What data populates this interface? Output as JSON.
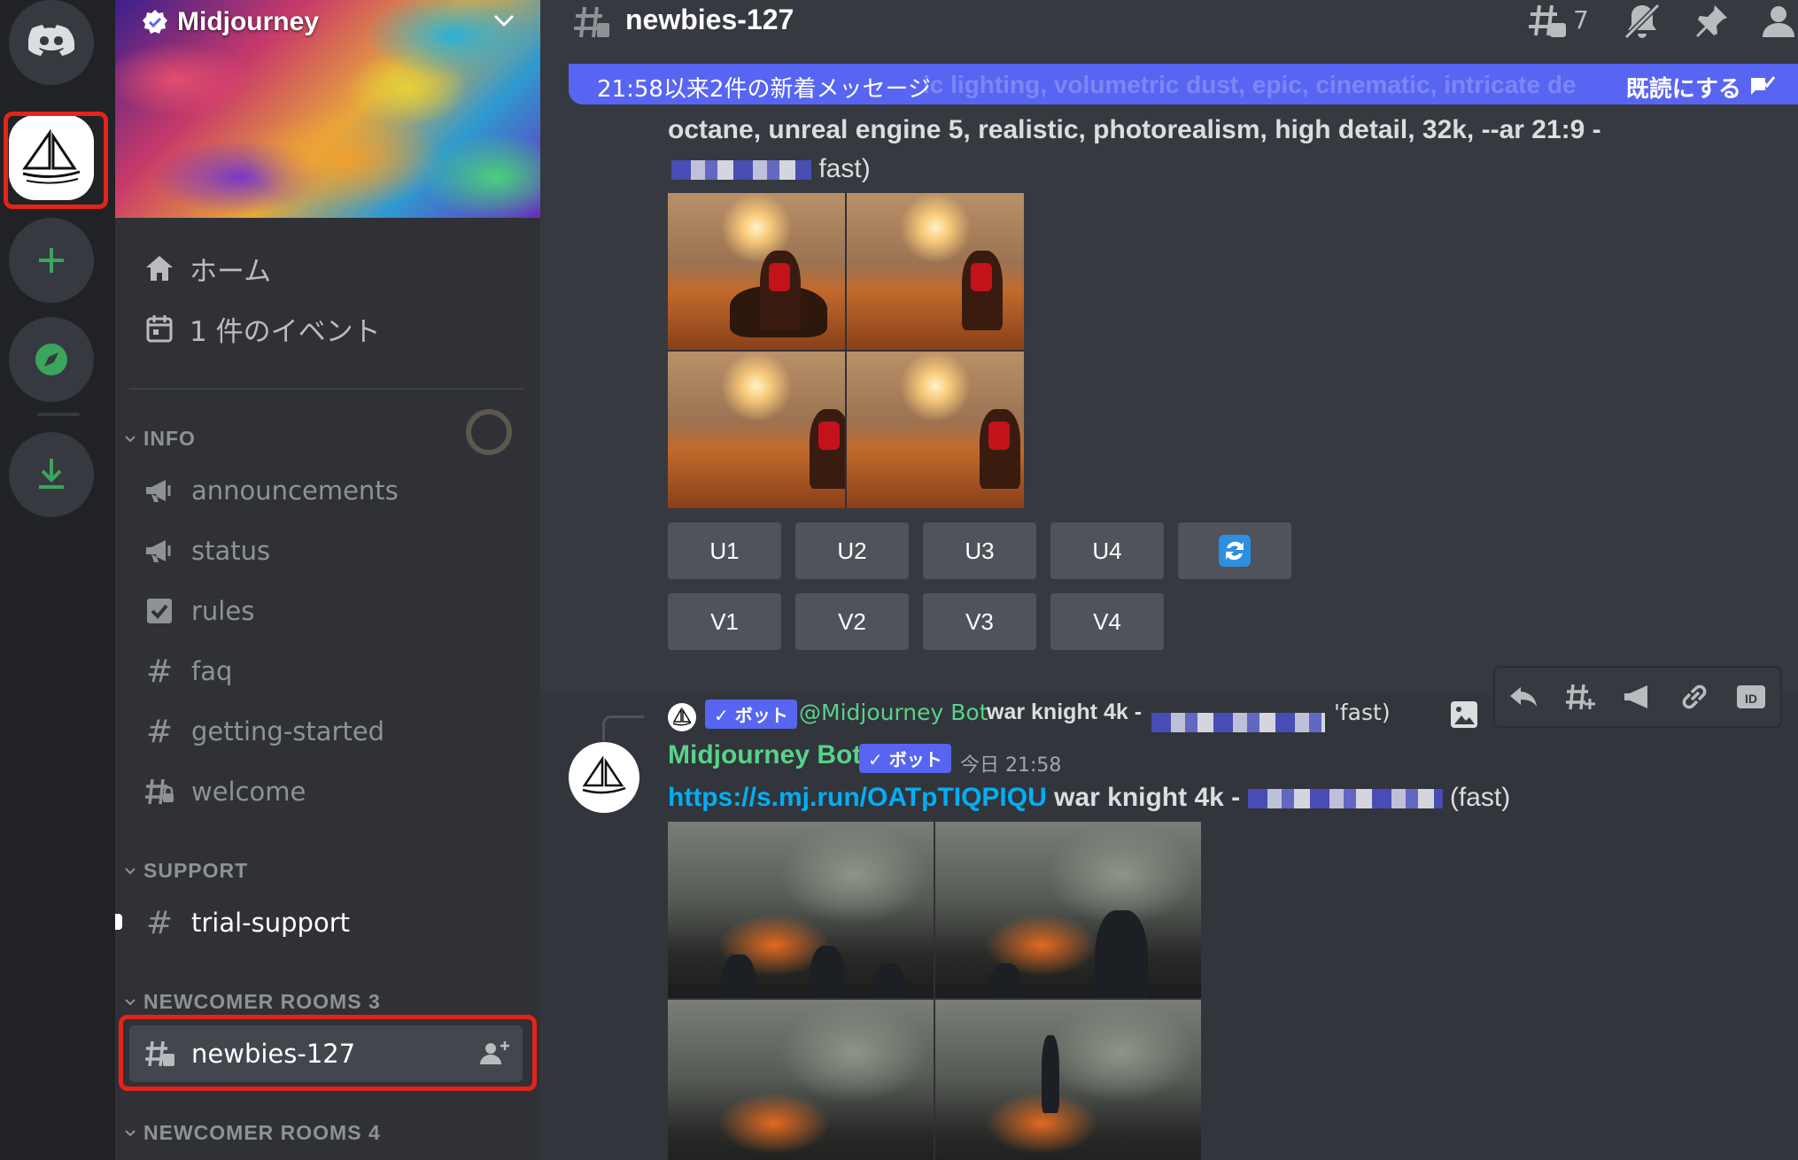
{
  "server": {
    "name": "Midjourney",
    "rail_icons": [
      "discord-home-icon",
      "midjourney-server-icon",
      "add-server-icon",
      "explore-icon",
      "download-icon"
    ]
  },
  "sidebar": {
    "nav": [
      {
        "label": "ホーム",
        "icon": "home-icon"
      },
      {
        "label": "1 件のイベント",
        "icon": "calendar-icon"
      }
    ],
    "categories": [
      {
        "name": "INFO",
        "channels": [
          {
            "label": "announcements",
            "icon": "megaphone-icon"
          },
          {
            "label": "status",
            "icon": "megaphone-icon"
          },
          {
            "label": "rules",
            "icon": "checkbox-icon"
          },
          {
            "label": "faq",
            "icon": "hash-icon"
          },
          {
            "label": "getting-started",
            "icon": "hash-icon"
          },
          {
            "label": "welcome",
            "icon": "hash-lock-icon"
          }
        ]
      },
      {
        "name": "SUPPORT",
        "channels": [
          {
            "label": "trial-support",
            "icon": "hash-icon"
          }
        ]
      },
      {
        "name": "NEWCOMER ROOMS 3",
        "channels": [
          {
            "label": "newbies-127",
            "icon": "hash-threads-icon",
            "selected": true
          }
        ]
      },
      {
        "name": "NEWCOMER ROOMS 4",
        "channels": []
      }
    ]
  },
  "header": {
    "channel": "newbies-127",
    "thread_count": "7"
  },
  "new_messages_bar": {
    "text": "21:58以来2件の新着メッセージ",
    "ghost_text": "ic lighting, volumetric dust, epic, cinematic, intricate de",
    "mark_read": "既読にする"
  },
  "message1": {
    "prompt_line1": "octane, unreal engine 5, realistic, photorealism, high detail, 32k, --ar 21:9 -",
    "prompt_line2_suffix": "fast)",
    "buttons_row1": [
      "U1",
      "U2",
      "U3",
      "U4"
    ],
    "buttons_row2": [
      "V1",
      "V2",
      "V3",
      "V4"
    ]
  },
  "message2": {
    "reply": {
      "bot_tag": "✓ ボット",
      "mention": "@Midjourney Bot",
      "prompt": "war knight 4k -",
      "suffix": "'fast)"
    },
    "author": "Midjourney Bot",
    "bot_tag": "✓ ボット",
    "timestamp": "今日 21:58",
    "link": "https://s.mj.run/OATpTIQPIQU",
    "prompt": "war knight 4k -",
    "suffix": "(fast)"
  },
  "colors": {
    "blurple": "#5865f2",
    "highlight_red": "#e3241b",
    "bot_green": "#57d38a",
    "link_blue": "#00aff4"
  }
}
